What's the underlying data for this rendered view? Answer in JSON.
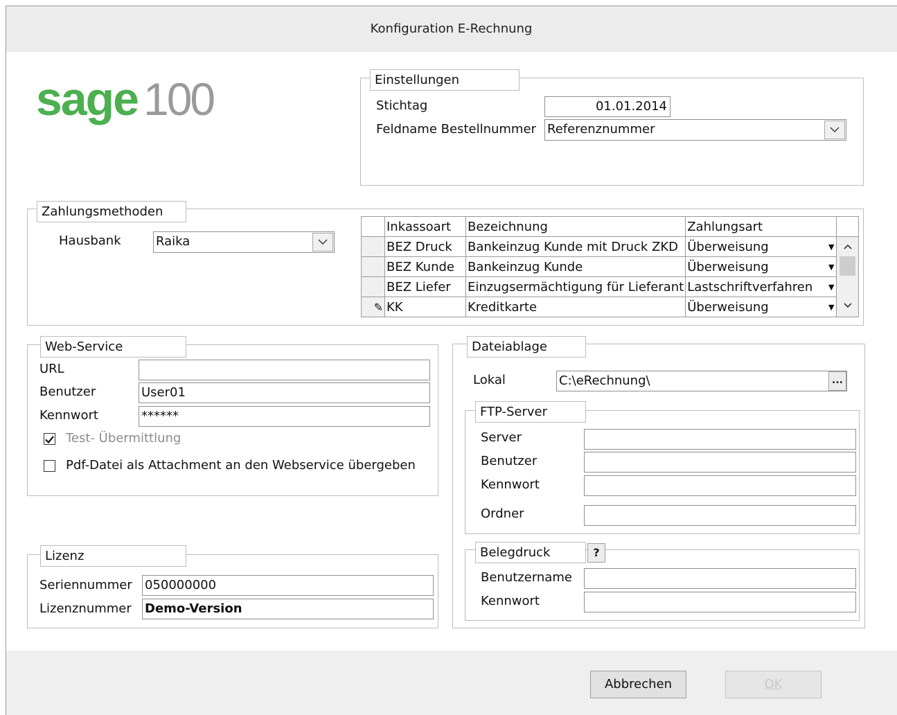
{
  "window": {
    "title": "Konfiguration E-Rechnung"
  },
  "logo": {
    "brand": "sage",
    "number": "100"
  },
  "einstellungen": {
    "legend": "Einstellungen",
    "stichtag_label": "Stichtag",
    "stichtag_value": "01.01.2014",
    "feldname_label": "Feldname Bestellnummer",
    "feldname_value": "Referenznummer"
  },
  "zahlungsmethoden": {
    "legend": "Zahlungsmethoden",
    "hausbank_label": "Hausbank",
    "hausbank_value": "Raika",
    "columns": [
      "Inkassoart",
      "Bezeichnung",
      "Zahlungsart"
    ],
    "rows": [
      {
        "inkassoart": "BEZ Druck",
        "bezeichnung": "Bankeinzug Kunde mit Druck ZKD",
        "zahlungsart": "Überweisung"
      },
      {
        "inkassoart": "BEZ Kunde",
        "bezeichnung": "Bankeinzug Kunde",
        "zahlungsart": "Überweisung"
      },
      {
        "inkassoart": "BEZ Liefer",
        "bezeichnung": "Einzugsermächtigung für Lieferant",
        "zahlungsart": "Lastschriftverfahren"
      },
      {
        "inkassoart": "KK",
        "bezeichnung": "Kreditkarte",
        "zahlungsart": "Überweisung"
      }
    ]
  },
  "webservice": {
    "legend": "Web-Service",
    "url_label": "URL",
    "url_value": "",
    "benutzer_label": "Benutzer",
    "benutzer_value": "User01",
    "kennwort_label": "Kennwort",
    "kennwort_value": "******",
    "test_label": "Test- Übermittlung",
    "test_checked": true,
    "pdf_label": "Pdf-Datei als Attachment an den Webservice übergeben",
    "pdf_checked": false
  },
  "lizenz": {
    "legend": "Lizenz",
    "seriennummer_label": "Seriennummer",
    "seriennummer_value": "050000000",
    "lizenznummer_label": "Lizenznummer",
    "lizenznummer_value": "Demo-Version"
  },
  "dateiablage": {
    "legend": "Dateiablage",
    "lokal_label": "Lokal",
    "lokal_value": "C:\\eRechnung\\",
    "browse_label": "...",
    "ftp": {
      "legend": "FTP-Server",
      "server_label": "Server",
      "benutzer_label": "Benutzer",
      "kennwort_label": "Kennwort",
      "ordner_label": "Ordner"
    },
    "belegdruck": {
      "legend": "Belegdruck",
      "help_label": "?",
      "benutzername_label": "Benutzername",
      "kennwort_label": "Kennwort"
    }
  },
  "buttons": {
    "cancel": "Abbrechen",
    "ok": "OK"
  },
  "colors": {
    "brand_green": "#4caf50"
  }
}
